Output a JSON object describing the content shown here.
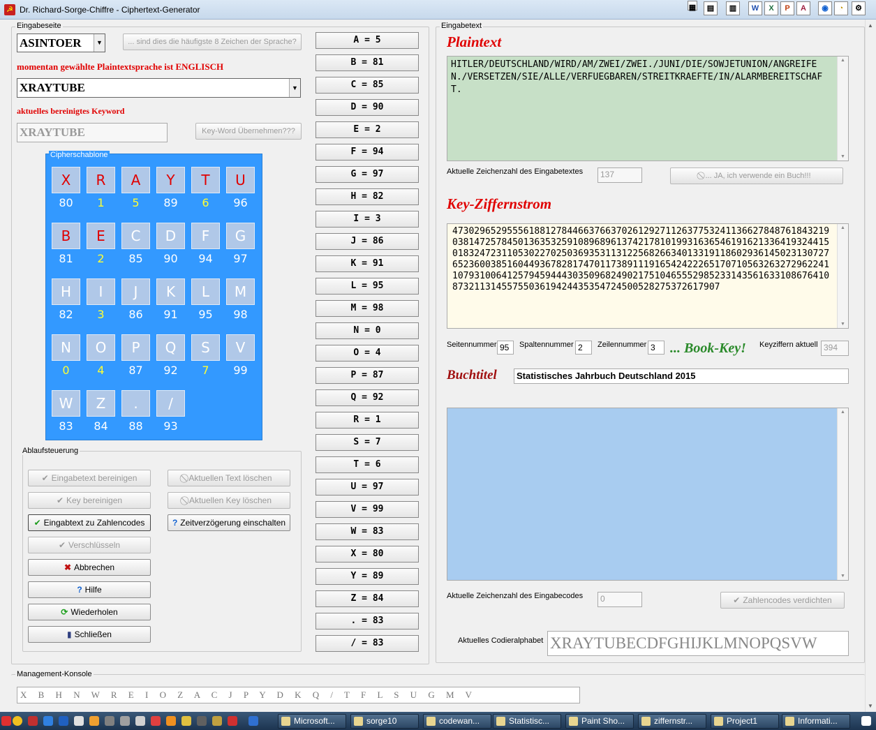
{
  "window": {
    "title": "Dr. Richard-Sorge-Chiffre - Ciphertext-Generator"
  },
  "left": {
    "group_label": "Eingabeseite",
    "language_select": "ASINTOER",
    "freq_button": "... sind dies die häufigste 8 Zeichen der Sprache?",
    "language_info": "momentan gewählte Plaintextsprache ist ENGLISCH",
    "keyword_select": "XRAYTUBE",
    "cleaned_keyword_label": "aktuelles bereinigtes Keyword",
    "cleaned_keyword": "XRAYTUBE",
    "take_keyword_button": "Key-Word Übernehmen???",
    "template_label": "Cipherschablone",
    "tiles": [
      {
        "c": "X",
        "n": "80",
        "red": true,
        "y": false
      },
      {
        "c": "R",
        "n": "1",
        "red": true,
        "y": true
      },
      {
        "c": "A",
        "n": "5",
        "red": true,
        "y": true
      },
      {
        "c": "Y",
        "n": "89",
        "red": true,
        "y": false
      },
      {
        "c": "T",
        "n": "6",
        "red": true,
        "y": true
      },
      {
        "c": "U",
        "n": "96",
        "red": true,
        "y": false
      },
      {
        "c": "B",
        "n": "81",
        "red": true,
        "y": false
      },
      {
        "c": "E",
        "n": "2",
        "red": true,
        "y": true
      },
      {
        "c": "C",
        "n": "85",
        "red": false,
        "y": false
      },
      {
        "c": "D",
        "n": "90",
        "red": false,
        "y": false
      },
      {
        "c": "F",
        "n": "94",
        "red": false,
        "y": false
      },
      {
        "c": "G",
        "n": "97",
        "red": false,
        "y": false
      },
      {
        "c": "H",
        "n": "82",
        "red": false,
        "y": false
      },
      {
        "c": "I",
        "n": "3",
        "red": false,
        "y": true
      },
      {
        "c": "J",
        "n": "86",
        "red": false,
        "y": false
      },
      {
        "c": "K",
        "n": "91",
        "red": false,
        "y": false
      },
      {
        "c": "L",
        "n": "95",
        "red": false,
        "y": false
      },
      {
        "c": "M",
        "n": "98",
        "red": false,
        "y": false
      },
      {
        "c": "N",
        "n": "0",
        "red": false,
        "y": true
      },
      {
        "c": "O",
        "n": "4",
        "red": false,
        "y": true
      },
      {
        "c": "P",
        "n": "87",
        "red": false,
        "y": false
      },
      {
        "c": "Q",
        "n": "92",
        "red": false,
        "y": false
      },
      {
        "c": "S",
        "n": "7",
        "red": false,
        "y": true
      },
      {
        "c": "V",
        "n": "99",
        "red": false,
        "y": false
      },
      {
        "c": "W",
        "n": "83",
        "red": false,
        "y": false
      },
      {
        "c": "Z",
        "n": "84",
        "red": false,
        "y": false
      },
      {
        "c": ".",
        "n": "88",
        "red": false,
        "y": false
      },
      {
        "c": "/",
        "n": "93",
        "red": false,
        "y": false
      }
    ],
    "flow_label": "Ablaufsteuerung",
    "buttons": {
      "clean_text": "Eingabetext bereinigen",
      "delete_text": "Aktuellen Text löschen",
      "clean_key": "Key bereinigen",
      "delete_key": "Aktuellen Key löschen",
      "to_codes": "Eingabtext zu Zahlencodes",
      "delay": "Zeitverzögerung einschalten",
      "encrypt": "Verschlüsseln",
      "cancel": "Abbrechen",
      "help": "Hilfe",
      "repeat": "Wiederholen",
      "close": "Schließen"
    }
  },
  "letters": [
    "A = 5",
    "B = 81",
    "C = 85",
    "D = 90",
    "E = 2",
    "F = 94",
    "G = 97",
    "H = 82",
    "I = 3",
    "J = 86",
    "K = 91",
    "L = 95",
    "M = 98",
    "N = 0",
    "O = 4",
    "P = 87",
    "Q = 92",
    "R = 1",
    "S = 7",
    "T = 6",
    "U = 97",
    "V = 99",
    "W = 83",
    "X = 80",
    "Y = 89",
    "Z = 84",
    ". = 83",
    "/ = 83"
  ],
  "right": {
    "group_label": "Eingabetext",
    "plaintext_title": "Plaintext",
    "plaintext": "HITLER/DEUTSCHLAND/WIRD/AM/ZWEI/ZWEI./JUNI/DIE/SOWJETUNION/ANGREIFEN./VERSETZEN/SIE/ALLE/VERFUEGBAREN/STREITKRAEFTE/IN/ALARMBEREITSCHAFT.",
    "char_count_label": "Aktuelle Zeichenzahl des Eingabetextes",
    "char_count": "137",
    "book_button": "... JA, ich verwende ein Buch!!!",
    "key_title": "Key-Ziffernstrom",
    "key_stream": "4730296529555618812784466376637026129271126377532411366278487618432190381472578450136353259108968961374217810199316365461916213364193244150183247231105302270250369353113122568266340133191186029361450231307276523600385160449367828174701173891119165424222651707105632632729622411079310064125794594443035096824902175104655529852331435616331086764108732113145575503619424435354724500528275372617907",
    "page_label": "Seitennummer",
    "page": "95",
    "column_label": "Spaltennummer",
    "column": "2",
    "line_label": "Zeilennummer",
    "line": "3",
    "book_key": "... Book-Key!",
    "key_digits_label": "Keyziffern aktuell",
    "key_digits": "394",
    "book_title_label": "Buchtitel",
    "book_title": "Statistisches Jahrbuch Deutschland 2015",
    "codes_count_label": "Aktuelle Zeichenzahl des Eingabecodes",
    "codes_count": "0",
    "compress_button": "Zahlencodes verdichten",
    "alphabet_label": "Aktuelles Codieralphabet",
    "alphabet": "XRAYTUBECDFGHIJKLMNOPQSVW"
  },
  "console": {
    "label": "Management-Konsole",
    "value": "X B H N W R E I O Z A C J P Y D K Q / T F L S U G M V"
  },
  "taskbar": [
    "Microsoft...",
    "sorge10",
    "codewan...",
    "Statistisc...",
    "Paint Sho...",
    "ziffernstr...",
    "Project1",
    "Informati..."
  ]
}
